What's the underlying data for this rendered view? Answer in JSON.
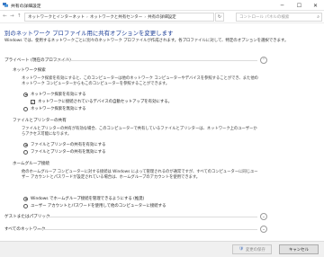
{
  "window": {
    "title": "共有の詳細設定",
    "min_symbol": "─",
    "max_symbol": "☐",
    "close_symbol": "✕"
  },
  "nav": {
    "back_symbol": "←",
    "forward_symbol": "→",
    "up_symbol": "↑",
    "breadcrumb": [
      "ネットワークとインターネット",
      "ネットワークと共有センター",
      "共有の詳細設定"
    ],
    "refresh_symbol": "↻",
    "search_placeholder": "コントロール パネルの検索"
  },
  "main": {
    "heading": "別のネットワーク プロファイル用に共有オプションを変更します",
    "description": "Windows では、使用するネットワークごとに別々のネットワーク プロファイルが作成されます。各プロファイルに対して、特定のオプションを選択できます。",
    "private": {
      "title": "プライベート (現在のプロファイル)",
      "network_discovery": {
        "title": "ネットワーク探索",
        "description": "ネットワーク探索を有効にすると、このコンピューターは他のネットワーク コンピューターやデバイスを参照することができ、また他のネットワーク コンピューターからもこのコンピューターを参照することができます。",
        "on_label": "ネットワーク探索を有効にする",
        "auto_setup_label": "ネットワークに接続されているデバイスの自動セットアップを有効にする。",
        "off_label": "ネットワーク探索を無効にする"
      },
      "file_printer": {
        "title": "ファイルとプリンターの共有",
        "description": "ファイルとプリンターの共有が有効な場合、このコンピューターで共有しているファイルとプリンターは、ネットワーク上のユーザーからアクセス可能になります。",
        "on_label": "ファイルとプリンターの共有を有効にする",
        "off_label": "ファイルとプリンターの共有を無効にする"
      },
      "homegroup": {
        "title": "ホームグループ接続",
        "description": "他のホームグループ コンピューターに対する接続は Windows によって管理されるのが通常ですが、すべてのコンピューターに同じユーザー アカウントとパスワードが設定されている場合は、ホームグループのアカウントを使用できます。",
        "option1_label": "Windows でホームグループ接続を管理できるようにする (推奨)",
        "option2_label": "ユーザー アカウントとパスワードを使用して他のコンピューターに接続する"
      }
    },
    "guest_public": "ゲストまたはパブリック",
    "all_networks": "すべてのネットワーク",
    "chevron_up": "⌃",
    "chevron_down": "⌄"
  },
  "footer": {
    "save_label": "変更の保存",
    "cancel_label": "キャンセル",
    "shield_symbol": "🛡"
  }
}
